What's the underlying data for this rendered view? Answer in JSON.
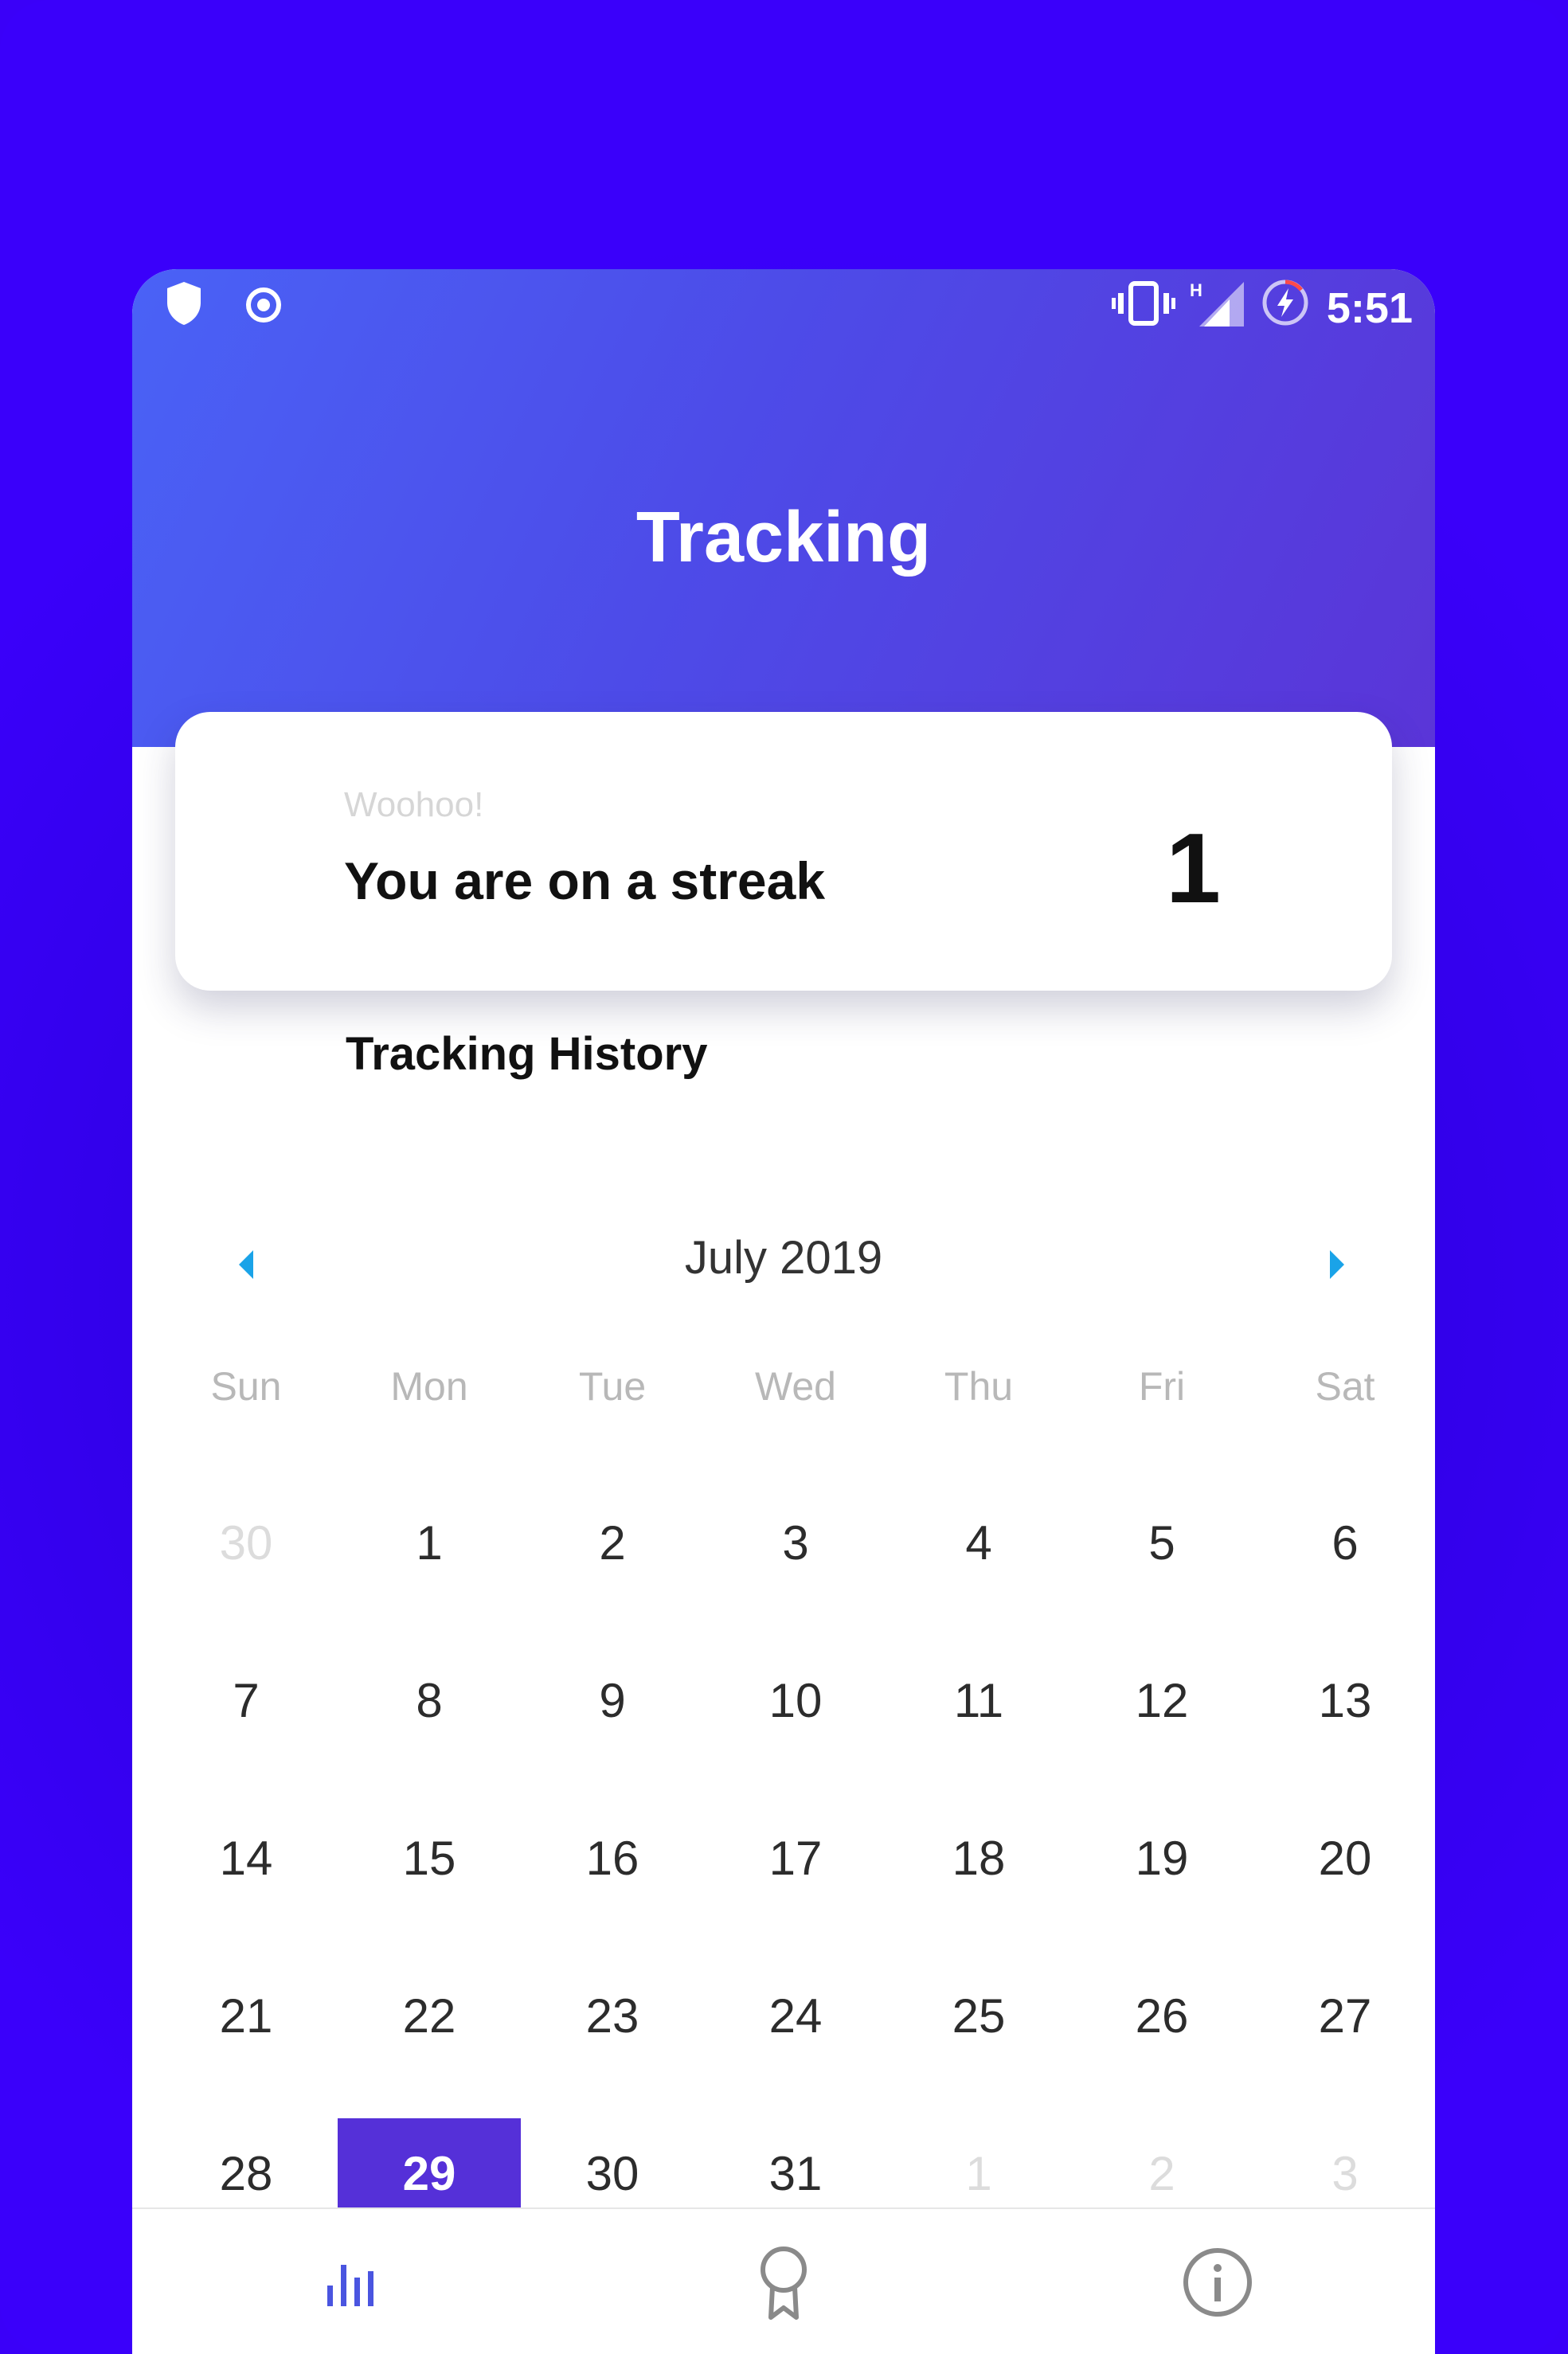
{
  "status_bar": {
    "time": "5:51"
  },
  "header": {
    "title": "Tracking"
  },
  "streak_card": {
    "subtitle": "Woohoo!",
    "title": "You are on a streak",
    "count": "1"
  },
  "history": {
    "title": "Tracking History"
  },
  "calendar": {
    "month": "July 2019",
    "weekdays": [
      "Sun",
      "Mon",
      "Tue",
      "Wed",
      "Thu",
      "Fri",
      "Sat"
    ],
    "weeks": [
      [
        {
          "d": "30",
          "muted": true
        },
        {
          "d": "1"
        },
        {
          "d": "2"
        },
        {
          "d": "3"
        },
        {
          "d": "4"
        },
        {
          "d": "5"
        },
        {
          "d": "6"
        }
      ],
      [
        {
          "d": "7"
        },
        {
          "d": "8"
        },
        {
          "d": "9"
        },
        {
          "d": "10"
        },
        {
          "d": "11"
        },
        {
          "d": "12"
        },
        {
          "d": "13"
        }
      ],
      [
        {
          "d": "14"
        },
        {
          "d": "15"
        },
        {
          "d": "16"
        },
        {
          "d": "17"
        },
        {
          "d": "18"
        },
        {
          "d": "19"
        },
        {
          "d": "20"
        }
      ],
      [
        {
          "d": "21"
        },
        {
          "d": "22"
        },
        {
          "d": "23"
        },
        {
          "d": "24"
        },
        {
          "d": "25"
        },
        {
          "d": "26"
        },
        {
          "d": "27"
        }
      ],
      [
        {
          "d": "28"
        },
        {
          "d": "29",
          "selected": true
        },
        {
          "d": "30"
        },
        {
          "d": "31"
        },
        {
          "d": "1",
          "muted": true
        },
        {
          "d": "2",
          "muted": true
        },
        {
          "d": "3",
          "muted": true
        }
      ]
    ],
    "selected_color": "#5530d8",
    "nav_arrow_color": "#1aa3e8"
  },
  "bottom_nav": {
    "items": [
      {
        "icon": "bar-chart-icon",
        "active": true
      },
      {
        "icon": "award-ribbon-icon",
        "active": false
      },
      {
        "icon": "info-icon",
        "active": false
      }
    ],
    "active_color": "#4a55e0",
    "inactive_color": "#8a8a8a"
  },
  "colors": {
    "background": "#3a00f8",
    "header_start": "#4a62f6",
    "header_end": "#5a35d8"
  }
}
